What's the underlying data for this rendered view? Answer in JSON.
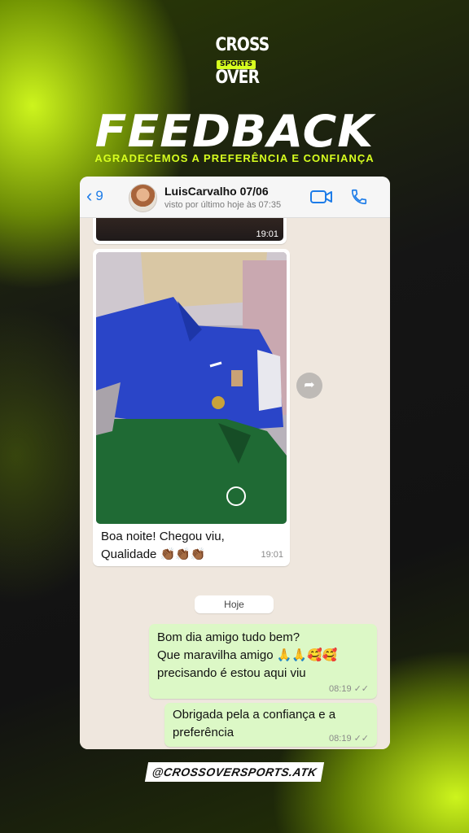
{
  "brand": {
    "logo_line1": "CROSS",
    "logo_line2": "SPORTS",
    "logo_line3": "OVER",
    "accent": "#d7ff1f"
  },
  "hero": {
    "title": "FEEDBACK",
    "subtitle": "AGRADECEMOS A PREFERÊNCIA E CONFIANÇA"
  },
  "chat_header": {
    "back_count": "9",
    "contact_name": "LuisCarvalho 07/06",
    "status": "visto por último hoje às 07:35",
    "icons": [
      "chevron-left-icon",
      "video-call-icon",
      "phone-call-icon"
    ]
  },
  "messages": [
    {
      "direction": "incoming",
      "kind": "image-top-partial",
      "time": "19:01"
    },
    {
      "direction": "incoming",
      "kind": "image",
      "caption_line1": "Boa noite! Chegou viu,",
      "caption_line2": "Qualidade 👏🏾👏🏾👏🏾",
      "time": "19:01"
    },
    {
      "direction": "outgoing",
      "line1": "Bom dia amigo tudo bem?",
      "line2": "Que maravilha amigo 🙏🙏🥰🥰",
      "line3": "precisando é estou aqui viu",
      "time": "08:19",
      "status": "read"
    },
    {
      "direction": "outgoing",
      "line1": "Obrigada pela a confiança e a",
      "line2": "preferência",
      "time": "08:19",
      "status": "read"
    }
  ],
  "day_separator": "Hoje",
  "footer": {
    "handle": "@CROSSOVERSPORTS.ATK"
  },
  "colors": {
    "outgoing_bubble": "#dcf8c6",
    "incoming_bubble": "#ffffff",
    "chat_bg": "#efe7de",
    "ios_blue": "#1d7ce8"
  }
}
